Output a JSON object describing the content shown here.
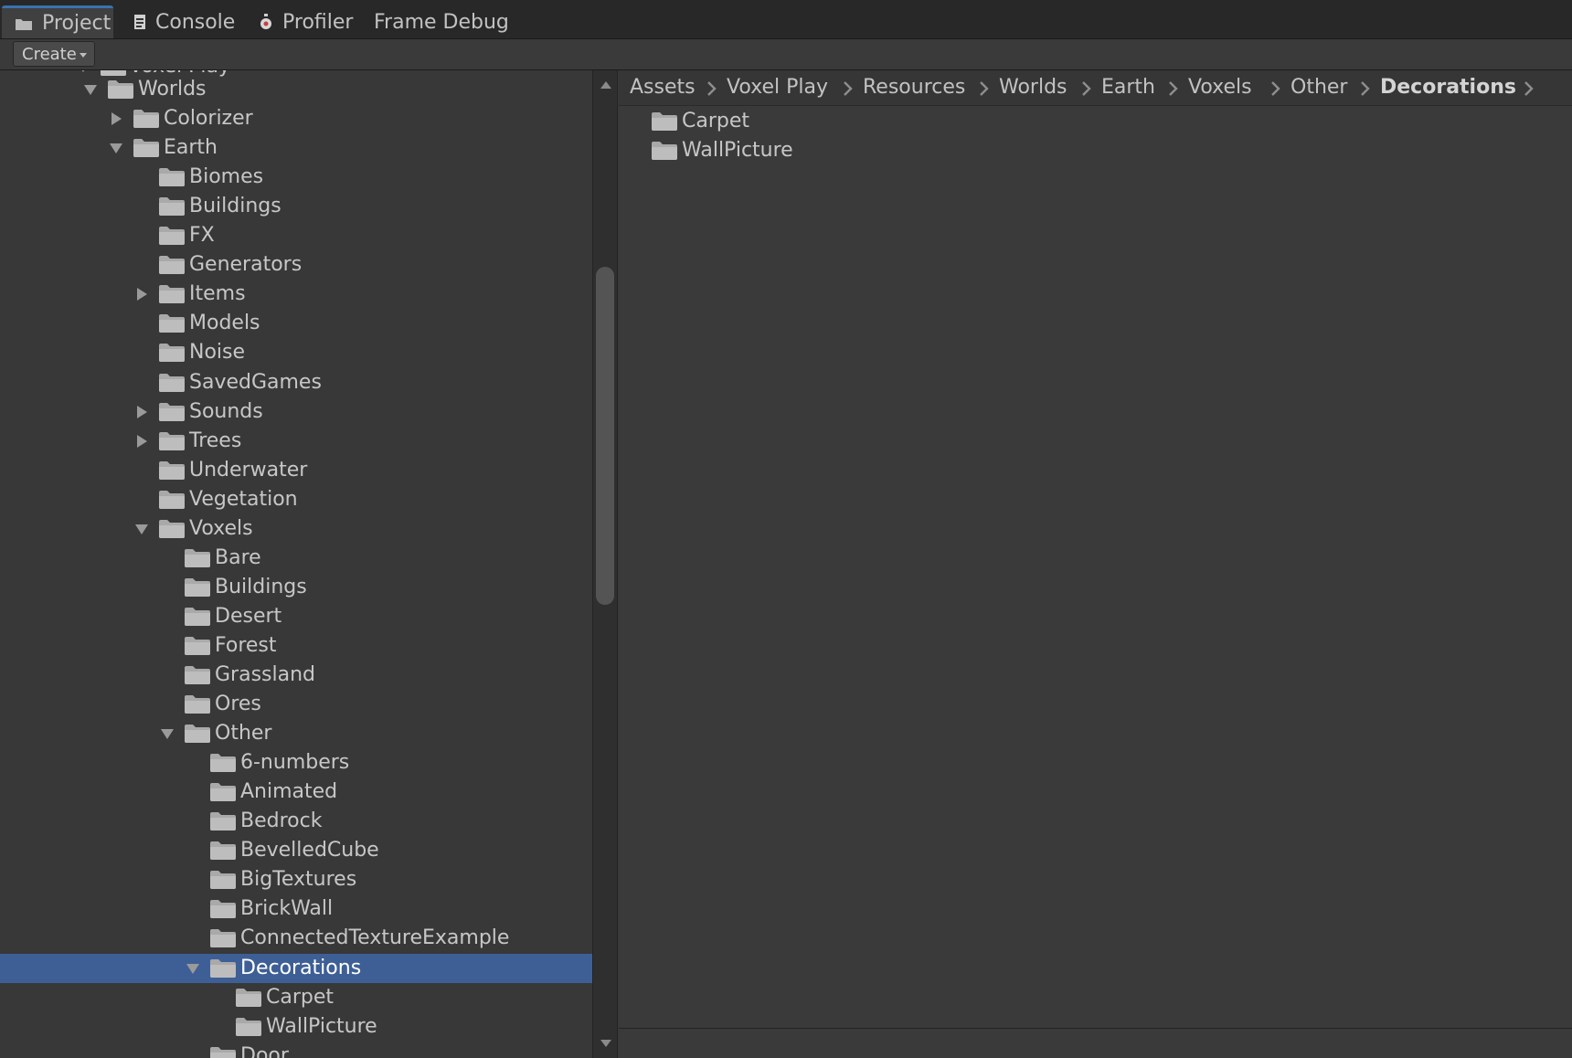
{
  "tabs": [
    {
      "label": "Project",
      "icon": "folder-icon",
      "active": true
    },
    {
      "label": "Console",
      "icon": "console-icon",
      "active": false
    },
    {
      "label": "Profiler",
      "icon": "profiler-icon",
      "active": false
    },
    {
      "label": "Frame Debug",
      "icon": "",
      "active": false
    }
  ],
  "toolbar": {
    "create_label": "Create"
  },
  "tree": {
    "partial_top_label": "Voxel Play",
    "items": [
      {
        "label": "Worlds",
        "state": "expanded"
      },
      {
        "label": "Colorizer",
        "state": "collapsed"
      },
      {
        "label": "Earth",
        "state": "expanded"
      },
      {
        "label": "Biomes",
        "state": "none"
      },
      {
        "label": "Buildings",
        "state": "none"
      },
      {
        "label": "FX",
        "state": "none"
      },
      {
        "label": "Generators",
        "state": "none"
      },
      {
        "label": "Items",
        "state": "collapsed"
      },
      {
        "label": "Models",
        "state": "none"
      },
      {
        "label": "Noise",
        "state": "none"
      },
      {
        "label": "SavedGames",
        "state": "none"
      },
      {
        "label": "Sounds",
        "state": "collapsed"
      },
      {
        "label": "Trees",
        "state": "collapsed"
      },
      {
        "label": "Underwater",
        "state": "none"
      },
      {
        "label": "Vegetation",
        "state": "none"
      },
      {
        "label": "Voxels",
        "state": "expanded"
      },
      {
        "label": "Bare",
        "state": "none"
      },
      {
        "label": "Buildings",
        "state": "none"
      },
      {
        "label": "Desert",
        "state": "none"
      },
      {
        "label": "Forest",
        "state": "none"
      },
      {
        "label": "Grassland",
        "state": "none"
      },
      {
        "label": "Ores",
        "state": "none"
      },
      {
        "label": "Other",
        "state": "expanded"
      },
      {
        "label": "6-numbers",
        "state": "none"
      },
      {
        "label": "Animated",
        "state": "none"
      },
      {
        "label": "Bedrock",
        "state": "none"
      },
      {
        "label": "BevelledCube",
        "state": "none"
      },
      {
        "label": "BigTextures",
        "state": "none"
      },
      {
        "label": "BrickWall",
        "state": "none"
      },
      {
        "label": "ConnectedTextureExample",
        "state": "none"
      },
      {
        "label": "Decorations",
        "state": "expanded",
        "selected": true
      },
      {
        "label": "Carpet",
        "state": "none"
      },
      {
        "label": "WallPicture",
        "state": "none"
      },
      {
        "label": "Door",
        "state": "none"
      }
    ]
  },
  "breadcrumb": [
    "Assets",
    "Voxel Play",
    "Resources",
    "Worlds",
    "Earth",
    "Voxels",
    "Other",
    "Decorations"
  ],
  "content": {
    "items": [
      {
        "label": "Carpet",
        "icon": "folder-icon"
      },
      {
        "label": "WallPicture",
        "icon": "folder-icon"
      }
    ]
  },
  "colors": {
    "background": "#383838",
    "selection": "#3e5f96",
    "tab_accent": "#3a72b0",
    "folder": "#a9a9a9"
  }
}
